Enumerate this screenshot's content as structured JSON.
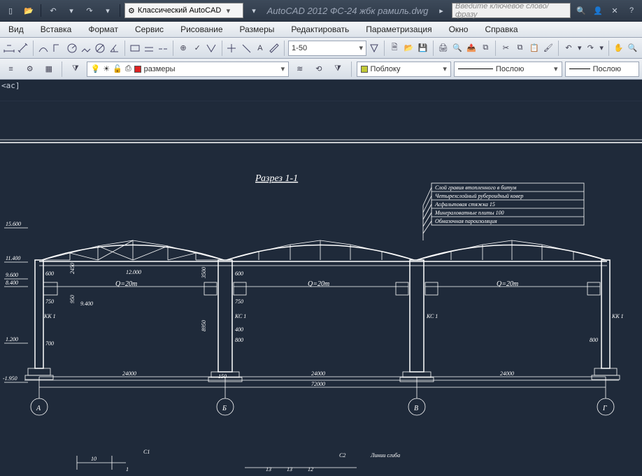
{
  "titlebar": {
    "workspace_label": "Классический AutoCAD",
    "app_title": "AutoCAD 2012    ФС-24 жбк рамиль.dwg",
    "search_placeholder": "Введите ключевое слово/фразу"
  },
  "menu": {
    "items": [
      "Вид",
      "Вставка",
      "Формат",
      "Сервис",
      "Рисование",
      "Размеры",
      "Редактировать",
      "Параметризация",
      "Окно",
      "Справка"
    ]
  },
  "toolrow1": {
    "scale_value": "1-50"
  },
  "proprow": {
    "layer_value": "размеры",
    "color_value": "Поблоку",
    "linetype_value": "Послою",
    "lineweight_value": "Послою"
  },
  "cmdline": "<ас]",
  "drawing": {
    "title": "Разрез 1-1",
    "notes": [
      "Слой гравия втопленного в битум",
      "Четырехслойный рубероидный ковер",
      "Асфальтовая стяжка 15",
      "Минераловатные плиты 100",
      "Обмазочная пароизоляция"
    ],
    "elevations": [
      "15.600",
      "11.400",
      "9.600",
      "8.400",
      "1.200",
      "-1.950"
    ],
    "dims": {
      "span1": "24000",
      "span2": "24000",
      "span3": "24000",
      "total": "72000",
      "q_label": "Q=20m",
      "h600": "600",
      "h2450": "2450",
      "h12000": "12.000",
      "h3500": "3500",
      "h750": "750",
      "h950": "950",
      "h9400": "9.400",
      "h400": "400",
      "h800": "800",
      "h8950": "8950",
      "h700": "700",
      "h150": "150"
    },
    "labels": {
      "kk1": "КК 1",
      "kc1": "КС 1"
    },
    "axes": [
      "А",
      "Б",
      "В",
      "Г"
    ],
    "lower": {
      "vals": [
        "10",
        "1",
        "С1",
        "13",
        "13",
        "12",
        "С2",
        "Линии  сгиба"
      ]
    }
  }
}
